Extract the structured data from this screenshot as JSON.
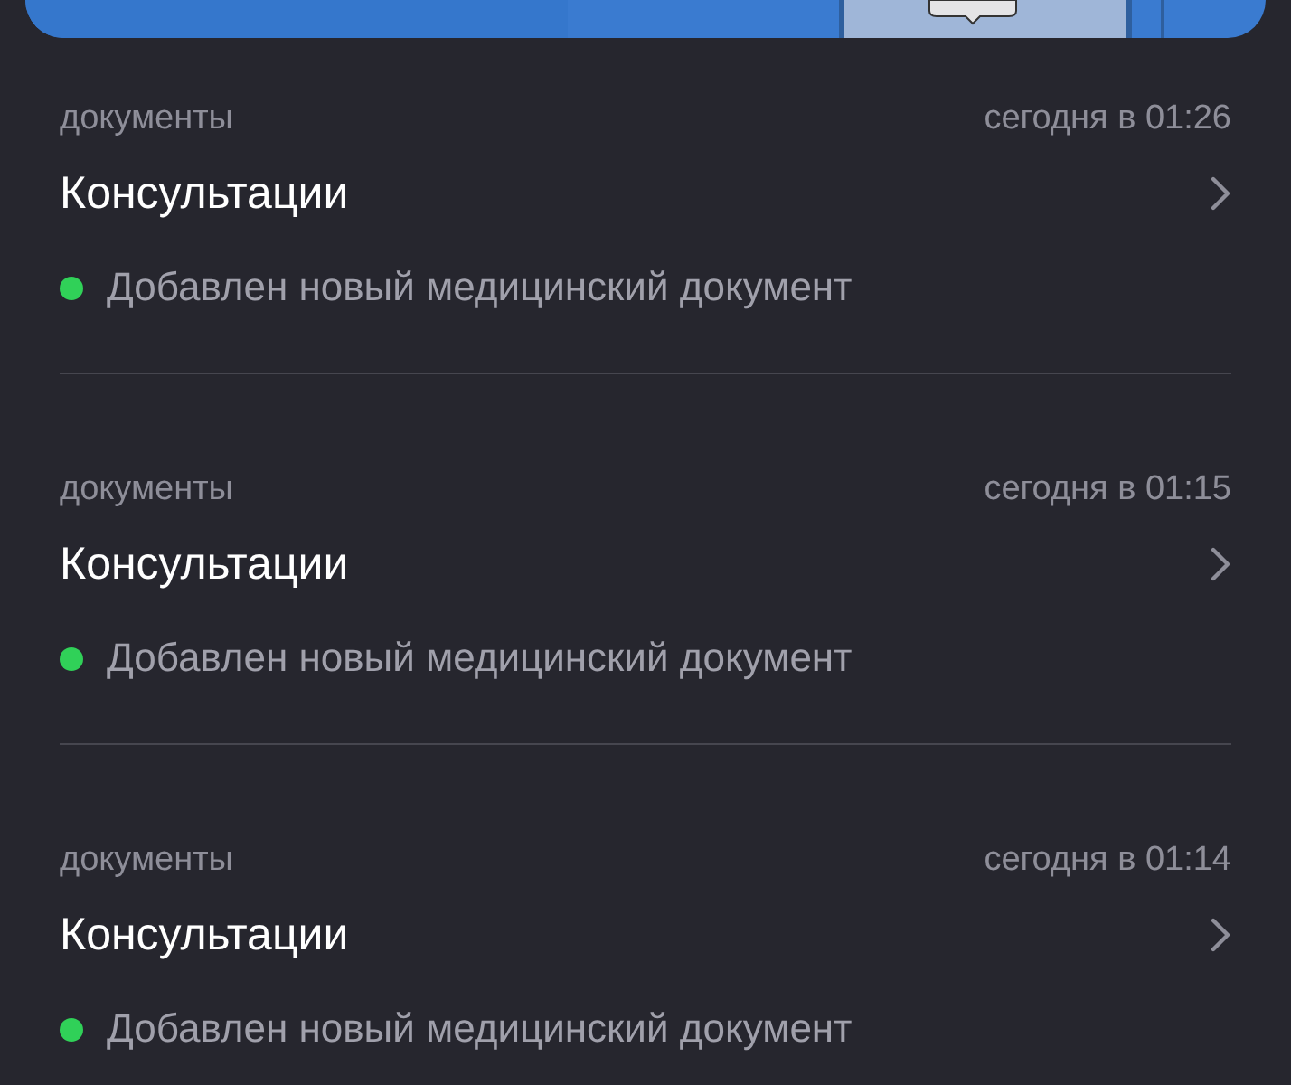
{
  "notifications": [
    {
      "category": "документы",
      "time": "сегодня в 01:26",
      "title": "Консультации",
      "status": "Добавлен новый медицинский документ"
    },
    {
      "category": "документы",
      "time": "сегодня в 01:15",
      "title": "Консультации",
      "status": "Добавлен новый медицинский документ"
    },
    {
      "category": "документы",
      "time": "сегодня в 01:14",
      "title": "Консультации",
      "status": "Добавлен новый медицинский документ"
    }
  ]
}
